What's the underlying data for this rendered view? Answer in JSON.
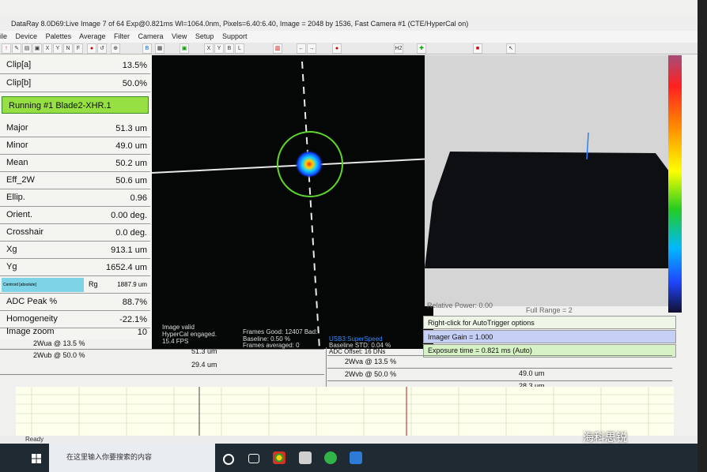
{
  "window": {
    "title": "DataRay 8.0D69:Live Image 7 of 64    Exp@0.821ms    Wl=1064.0nm, Pixels=6.40:6.40, Image = 2048 by 1536, Fast    Camera #1  (CTE/HyperCal on)"
  },
  "menu": [
    "ile",
    "Device",
    "Palettes",
    "Average",
    "Filter",
    "Camera",
    "View",
    "Setup",
    "Support"
  ],
  "toolbar": [
    "X",
    "Y",
    "B",
    "L",
    "H2",
    "N",
    "F"
  ],
  "clip": [
    {
      "label": "Clip[a]",
      "value": "13.5%"
    },
    {
      "label": "Clip[b]",
      "value": "50.0%"
    }
  ],
  "running_label": "Running #1 Blade2-XHR.1",
  "measurements": [
    {
      "label": "Major",
      "value": "51.3 um"
    },
    {
      "label": "Minor",
      "value": "49.0 um"
    },
    {
      "label": "Mean",
      "value": "50.2 um"
    },
    {
      "label": "Eff_2W",
      "value": "50.6 um"
    },
    {
      "label": "Ellip.",
      "value": "0.96"
    },
    {
      "label": "Orient.",
      "value": "0.00 deg."
    },
    {
      "label": "Crosshair",
      "value": "0.0 deg."
    },
    {
      "label": "Xg",
      "value": "913.1 um"
    },
    {
      "label": "Yg",
      "value": "1652.4 um"
    }
  ],
  "centroid_row": {
    "tag": "Centroid [absolute]",
    "label": "Rg",
    "value": "1887.9 um"
  },
  "measurements2": [
    {
      "label": "ADC Peak %",
      "value": "88.7%"
    },
    {
      "label": "Homogeneity",
      "value": "-22.1%"
    },
    {
      "label": "Image zoom",
      "value": "10"
    }
  ],
  "image_status": {
    "line1": "Image valid",
    "line2": "HyperCal engaged.",
    "line3": "15.4 FPS",
    "frames_good": "Frames Good: 12407 Bad:",
    "usb": "USB3:SuperSpeed",
    "baseline": "Baseline: 0.50 %",
    "baseline_std": "Baseline STD:  0.04 %",
    "frames_avg": "Frames averaged: 0",
    "adc_offset": "ADC Offset: 16 DNs"
  },
  "right_panel": {
    "relative_power": "Relative Power: 0.00",
    "full_range": "Full Range = 2",
    "autotrigger": "Right-click for AutoTrigger options",
    "imager_gain": "Imager Gain = 1.000",
    "exposure": "Exposure time = 0.821 ms (Auto)"
  },
  "widths": {
    "left": [
      {
        "label": "2Wua @ 13.5 %",
        "value": "51.3 um"
      },
      {
        "label": "2Wub @ 50.0 %",
        "value": "29.4 um"
      }
    ],
    "right": [
      {
        "label": "2Wva @ 13.5 %",
        "value": "49.0 um"
      },
      {
        "label": "2Wvb @ 50.0 %",
        "value": "28.3 um"
      }
    ]
  },
  "status_text": "Ready",
  "taskbar": {
    "search_placeholder": "在这里输入你要搜索的内容"
  },
  "watermark": "海科思锐",
  "colors": {
    "running_bg": "#96e044",
    "imager_gain_bg": "#c6cff5",
    "exposure_bg": "#d7f2c4",
    "beam_bg": "#050707"
  }
}
